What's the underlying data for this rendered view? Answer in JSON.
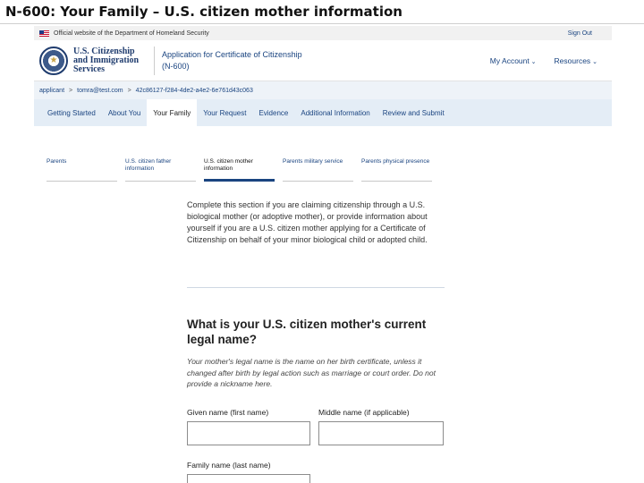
{
  "slide_title": "N-600: Your Family – U.S. citizen mother information",
  "banner": {
    "official_text": "Official website of the Department of Homeland Security",
    "sign_out": "Sign Out"
  },
  "header": {
    "agency_lines": [
      "U.S. Citizenship",
      "and Immigration",
      "Services"
    ],
    "app_title": "Application for Certificate of Citizenship",
    "app_code": "(N-600)",
    "my_account": "My Account",
    "resources": "Resources"
  },
  "breadcrumb": {
    "user": "applicant",
    "email": "tomra@test.com",
    "case_id": "42c86127-f284-4de2-a4e2-6e761d43c063"
  },
  "tabs": [
    {
      "label": "Getting Started",
      "active": false
    },
    {
      "label": "About You",
      "active": false
    },
    {
      "label": "Your Family",
      "active": true
    },
    {
      "label": "Your Request",
      "active": false
    },
    {
      "label": "Evidence",
      "active": false
    },
    {
      "label": "Additional Information",
      "active": false
    },
    {
      "label": "Review and Submit",
      "active": false
    }
  ],
  "subtabs": [
    {
      "label": "Parents",
      "active": false
    },
    {
      "label": "U.S. citizen father information",
      "active": false
    },
    {
      "label": "U.S. citizen mother information",
      "active": true
    },
    {
      "label": "Parents military service",
      "active": false
    },
    {
      "label": "Parents physical presence",
      "active": false
    }
  ],
  "main": {
    "intro": "Complete this section if you are claiming citizenship through a U.S. biological mother (or adoptive mother), or provide information about yourself if you are a U.S. citizen mother applying for a Certificate of Citizenship on behalf of your minor biological child or adopted child.",
    "question": "What is your U.S. citizen mother's current legal name?",
    "help": "Your mother's legal name is the name on her birth certificate, unless it changed after birth by legal action such as marriage or court order. Do not provide a nickname here.",
    "given_name_label": "Given name (first name)",
    "given_name_value": "",
    "middle_name_label": "Middle name (if applicable)",
    "middle_name_value": "",
    "family_name_label": "Family name (last name)",
    "family_name_value": ""
  },
  "colors": {
    "link": "#1a4480",
    "tab_bar": "#e4edf6",
    "breadcrumb_bg": "#eef3f8"
  }
}
